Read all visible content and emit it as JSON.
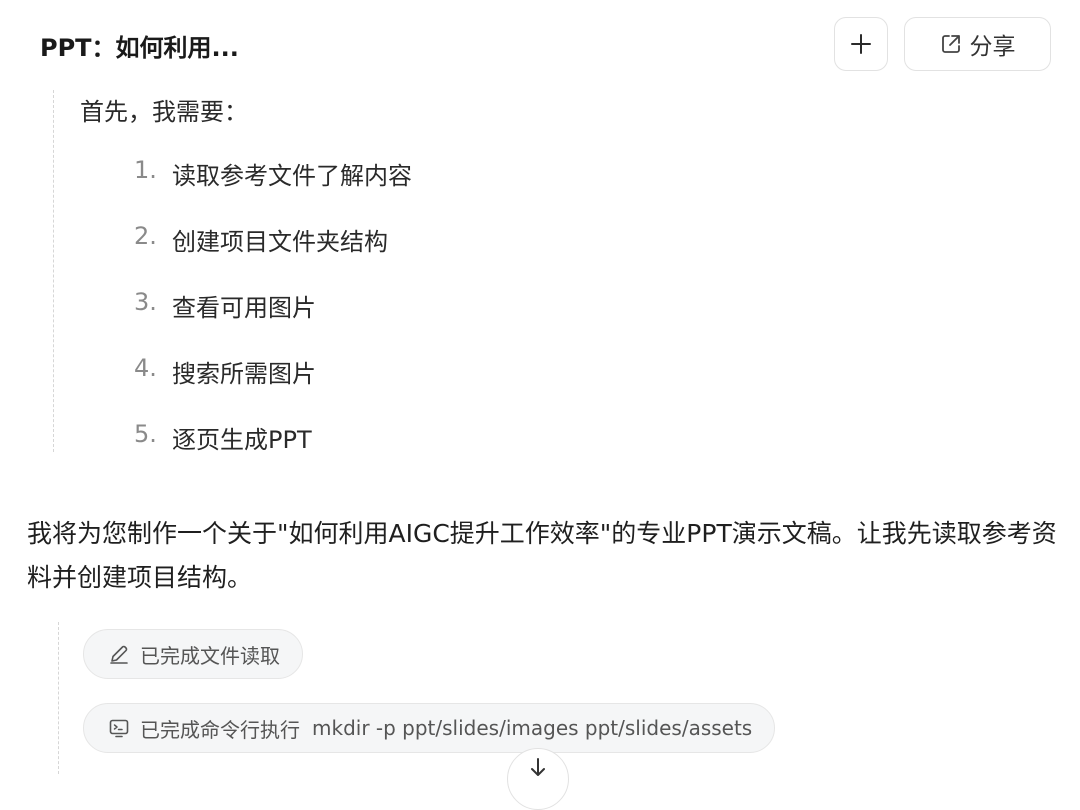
{
  "header": {
    "title": "PPT：如何利用...",
    "share_label": "分享",
    "icons": {
      "new": "plus-icon",
      "share": "share-icon"
    }
  },
  "thinking": {
    "intro": "首先，我需要：",
    "steps": [
      {
        "num": "1.",
        "text": "读取参考文件了解内容"
      },
      {
        "num": "2.",
        "text": "创建项目文件夹结构"
      },
      {
        "num": "3.",
        "text": "查看可用图片"
      },
      {
        "num": "4.",
        "text": "搜索所需图片"
      },
      {
        "num": "5.",
        "text": "逐页生成PPT"
      }
    ]
  },
  "message": {
    "text": "我将为您制作一个关于\"如何利用AIGC提升工作效率\"的专业PPT演示文稿。让我先读取参考资料并创建项目结构。"
  },
  "tools": [
    {
      "icon": "pencil-icon",
      "label": "已完成文件读取",
      "detail": ""
    },
    {
      "icon": "terminal-icon",
      "label": "已完成命令行执行",
      "detail": "mkdir -p ppt/slides/images ppt/slides/assets"
    }
  ],
  "scroll": {
    "icon": "arrow-down-icon"
  }
}
